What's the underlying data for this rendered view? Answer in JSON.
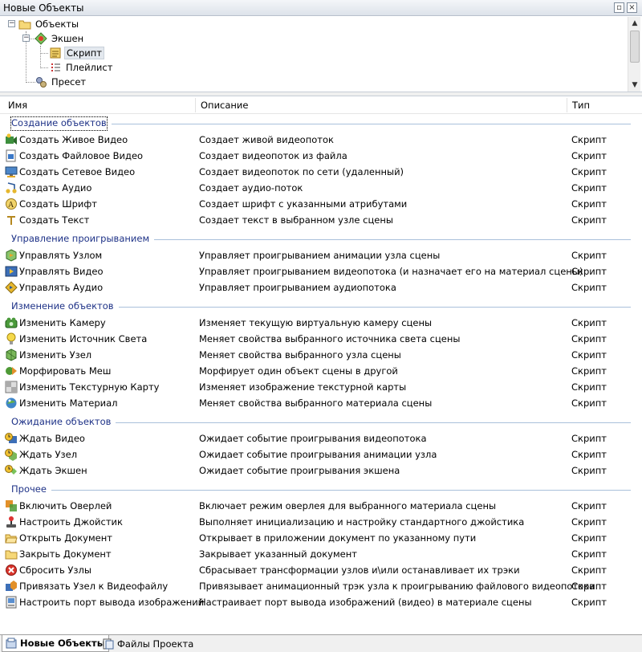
{
  "window": {
    "title": "Новые Объекты",
    "restore_icon": "restore-icon",
    "close_icon": "close-icon"
  },
  "tree": {
    "nodes": [
      {
        "label": "Объекты",
        "icon": "folder-icon",
        "expander": "−"
      },
      {
        "label": "Экшен",
        "icon": "action-icon",
        "expander": "−"
      },
      {
        "label": "Скрипт",
        "icon": "script-icon",
        "selected": true
      },
      {
        "label": "Плейлист",
        "icon": "playlist-icon"
      },
      {
        "label": "Пресет",
        "icon": "preset-icon"
      }
    ]
  },
  "list": {
    "headers": {
      "name": "Имя",
      "description": "Описание",
      "type": "Тип"
    },
    "groups": [
      {
        "title": "Создание объектов",
        "items": [
          {
            "name": "Создать Живое Видео",
            "description": "Создает живой видеопоток",
            "type": "Скрипт",
            "icon": "live-video-icon"
          },
          {
            "name": "Создать Файловое Видео",
            "description": "Создает видеопоток из файла",
            "type": "Скрипт",
            "icon": "file-video-icon"
          },
          {
            "name": "Создать Сетевое Видео",
            "description": "Создает видеопоток по сети (удаленный)",
            "type": "Скрипт",
            "icon": "network-video-icon"
          },
          {
            "name": "Создать Аудио",
            "description": "Создает аудио-поток",
            "type": "Скрипт",
            "icon": "audio-icon"
          },
          {
            "name": "Создать Шрифт",
            "description": "Создает шрифт с указанными атрибутами",
            "type": "Скрипт",
            "icon": "font-icon"
          },
          {
            "name": "Создать Текст",
            "description": "Создает текст в выбранном узле сцены",
            "type": "Скрипт",
            "icon": "text-icon"
          }
        ]
      },
      {
        "title": "Управление проигрыванием",
        "items": [
          {
            "name": "Управлять Узлом",
            "description": "Управляет проигрыванием анимации узла сцены",
            "type": "Скрипт",
            "icon": "node-control-icon"
          },
          {
            "name": "Управлять Видео",
            "description": "Управляет проигрыванием видеопотока (и назначает его на материал сцены)",
            "type": "Скрипт",
            "icon": "video-control-icon"
          },
          {
            "name": "Управлять Аудио",
            "description": "Управляет проигрыванием аудиопотока",
            "type": "Скрипт",
            "icon": "audio-control-icon"
          }
        ]
      },
      {
        "title": "Изменение объектов",
        "items": [
          {
            "name": "Изменить Камеру",
            "description": "Изменяет текущую виртуальную камеру сцены",
            "type": "Скрипт",
            "icon": "camera-icon"
          },
          {
            "name": "Изменить Источник Света",
            "description": "Меняет свойства выбранного источника света сцены",
            "type": "Скрипт",
            "icon": "light-bulb-icon"
          },
          {
            "name": "Изменить Узел",
            "description": "Меняет свойства выбранного узла сцены",
            "type": "Скрипт",
            "icon": "node-icon"
          },
          {
            "name": "Морфировать Меш",
            "description": "Морфирует один объект сцены в другой",
            "type": "Скрипт",
            "icon": "morph-icon"
          },
          {
            "name": "Изменить Текстурную Карту",
            "description": "Изменяет изображение текстурной карты",
            "type": "Скрипт",
            "icon": "texture-icon"
          },
          {
            "name": "Изменить Материал",
            "description": "Меняет свойства выбранного материала сцены",
            "type": "Скрипт",
            "icon": "material-icon"
          }
        ]
      },
      {
        "title": "Ожидание объектов",
        "items": [
          {
            "name": "Ждать Видео",
            "description": "Ожидает событие проигрывания видеопотока",
            "type": "Скрипт",
            "icon": "wait-video-icon"
          },
          {
            "name": "Ждать Узел",
            "description": "Ожидает событие проигрывания анимации узла",
            "type": "Скрипт",
            "icon": "wait-node-icon"
          },
          {
            "name": "Ждать Экшен",
            "description": "Ожидает событие проигрывания экшена",
            "type": "Скрипт",
            "icon": "wait-action-icon"
          }
        ]
      },
      {
        "title": "Прочее",
        "items": [
          {
            "name": "Включить Оверлей",
            "description": "Включает режим оверлея для выбранного материала сцены",
            "type": "Скрипт",
            "icon": "overlay-icon"
          },
          {
            "name": "Настроить Джойстик",
            "description": "Выполняет инициализацию и настройку стандартного джойстика",
            "type": "Скрипт",
            "icon": "joystick-icon"
          },
          {
            "name": "Открыть Документ",
            "description": "Открывает в приложении документ по указанному пути",
            "type": "Скрипт",
            "icon": "open-folder-icon"
          },
          {
            "name": "Закрыть Документ",
            "description": "Закрывает указанный документ",
            "type": "Скрипт",
            "icon": "closed-folder-icon"
          },
          {
            "name": "Сбросить Узлы",
            "description": "Сбрасывает трансформации узлов и\\или останавливает их трэки",
            "type": "Скрипт",
            "icon": "reset-icon"
          },
          {
            "name": "Привязать Узел к Видеофайлу",
            "description": "Привязывает анимационный трэк узла к проигрыванию файлового видеопотока",
            "type": "Скрипт",
            "icon": "bind-video-icon"
          },
          {
            "name": "Настроить порт вывода изображений",
            "description": "Настраивает порт вывода изображений (видео) в материале сцены",
            "type": "Скрипт",
            "icon": "output-port-icon"
          }
        ]
      }
    ]
  },
  "tabs": [
    {
      "label": "Новые Объекты",
      "active": true,
      "icon": "new-objects-icon"
    },
    {
      "label": "Файлы Проекта",
      "active": false,
      "icon": "project-files-icon"
    }
  ]
}
